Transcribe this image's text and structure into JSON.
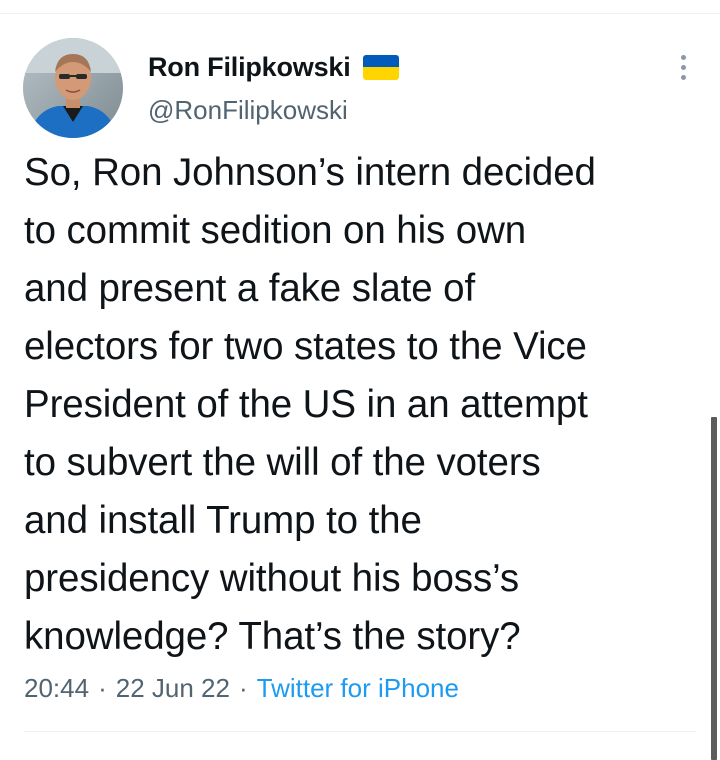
{
  "author": {
    "display_name": "Ron Filipkowski",
    "handle": "@RonFilipkowski",
    "flag_icon": "ukraine-flag-icon",
    "flag_colors": [
      "#005bbb",
      "#ffd500"
    ]
  },
  "tweet": {
    "lines": [
      "So, Ron Johnson’s intern decided",
      "to commit sedition on his own",
      "and present a fake slate of",
      "electors for two states to the Vice",
      "President of the US in an attempt",
      "to subvert the will of the voters",
      "and install Trump to the",
      "presidency without his boss’s",
      "knowledge? That’s the story?"
    ],
    "time": "20:44",
    "date": "22 Jun 22",
    "separator": "·",
    "source": "Twitter for iPhone"
  },
  "icons": {
    "more": "more-options-icon"
  },
  "colors": {
    "text": "#0f1419",
    "secondary": "#536471",
    "accent": "#1d9bf0"
  }
}
